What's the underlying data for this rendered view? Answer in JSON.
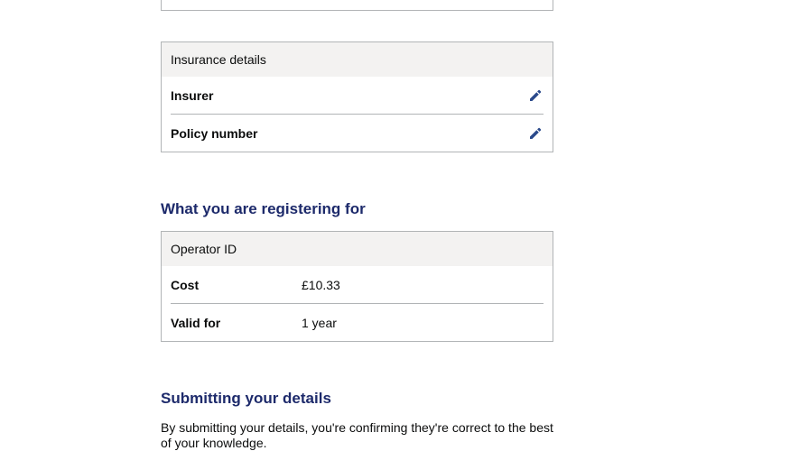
{
  "insurance": {
    "header": "Insurance details",
    "rows": [
      {
        "key": "Insurer",
        "value": ""
      },
      {
        "key": "Policy number",
        "value": ""
      }
    ]
  },
  "registering": {
    "heading": "What you are registering for",
    "header": "Operator ID",
    "rows": [
      {
        "key": "Cost",
        "value": "£10.33"
      },
      {
        "key": "Valid for",
        "value": "1 year"
      }
    ]
  },
  "submitting": {
    "heading": "Submitting your details",
    "text": "By submitting your details, you're confirming they're correct to the best of your knowledge."
  },
  "icons": {
    "edit": "pencil-icon"
  },
  "colors": {
    "heading": "#1d2a6b",
    "icon": "#2b4a8b",
    "card_header_bg": "#f3f2f1",
    "border": "#b1b4b6"
  }
}
